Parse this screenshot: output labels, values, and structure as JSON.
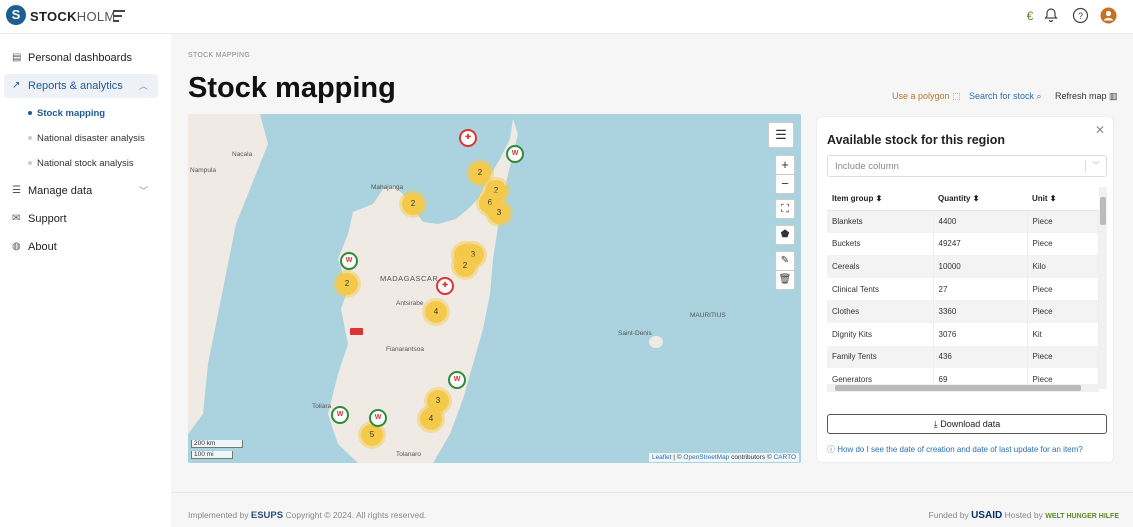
{
  "header": {
    "brand_bold": "STOCK",
    "brand_light": "HOLM",
    "logo_letter": "S"
  },
  "sidebar": {
    "items": [
      {
        "label": "Personal dashboards",
        "icon": "dashboard-icon"
      },
      {
        "label": "Reports & analytics",
        "icon": "chart-icon",
        "expanded": true
      },
      {
        "label": "Manage data",
        "icon": "sliders-icon"
      },
      {
        "label": "Support",
        "icon": "mail-icon"
      },
      {
        "label": "About",
        "icon": "globe-icon"
      }
    ],
    "sub_items": [
      {
        "label": "Stock mapping",
        "active": true
      },
      {
        "label": "National disaster analysis"
      },
      {
        "label": "National stock analysis"
      }
    ]
  },
  "page": {
    "breadcrumb": "STOCK MAPPING",
    "title": "Stock mapping"
  },
  "toolbar": {
    "polygon": "Use a polygon",
    "search": "Search for stock",
    "refresh": "Refresh map"
  },
  "map": {
    "labels": [
      "Nacala",
      "Nampula",
      "Mahajanga",
      "MADAGASCAR",
      "Antsirabe",
      "Fianarantsoa",
      "Toliara",
      "Tolanaro",
      "MAURITIUS",
      "Saint-Denis"
    ],
    "clusters": [
      "2",
      "2",
      "2",
      "6",
      "3",
      "3",
      "3",
      "2",
      "2",
      "4",
      "3",
      "4",
      "5"
    ],
    "scale": [
      "200 km",
      "100 mi"
    ],
    "attribution": {
      "leaflet": "Leaflet",
      "sep1": "| ©",
      "osm": "OpenStreetMap",
      "mid": "contributors ©",
      "carto": "CARTO"
    }
  },
  "panel": {
    "title": "Available stock for this region",
    "include_column": "Include column",
    "columns": [
      "Item group",
      "Quantity",
      "Unit"
    ],
    "rows": [
      [
        "Blankets",
        "4400",
        "Piece"
      ],
      [
        "Buckets",
        "49247",
        "Piece"
      ],
      [
        "Cereals",
        "10000",
        "Kilo"
      ],
      [
        "Clinical Tents",
        "27",
        "Piece"
      ],
      [
        "Clothes",
        "3360",
        "Piece"
      ],
      [
        "Dignity Kits",
        "3076",
        "Kit"
      ],
      [
        "Family Tents",
        "436",
        "Piece"
      ],
      [
        "Generators",
        "69",
        "Piece"
      ]
    ],
    "download": "Download data",
    "help": "How do I see the date of creation and date of last update for an item?"
  },
  "footer": {
    "implemented": "Implemented by",
    "esups": "ESUPS",
    "copyright": "Copyright © 2024. All rights reserved.",
    "funded": "Funded by",
    "usaid": "USAID",
    "hosted": "Hosted by",
    "whh": "WELT HUNGER HILFE"
  },
  "colors": {
    "accent": "#1e5a94",
    "cluster": "#f5c94a",
    "link": "#2a6fb0",
    "tool": "#b5762a"
  }
}
